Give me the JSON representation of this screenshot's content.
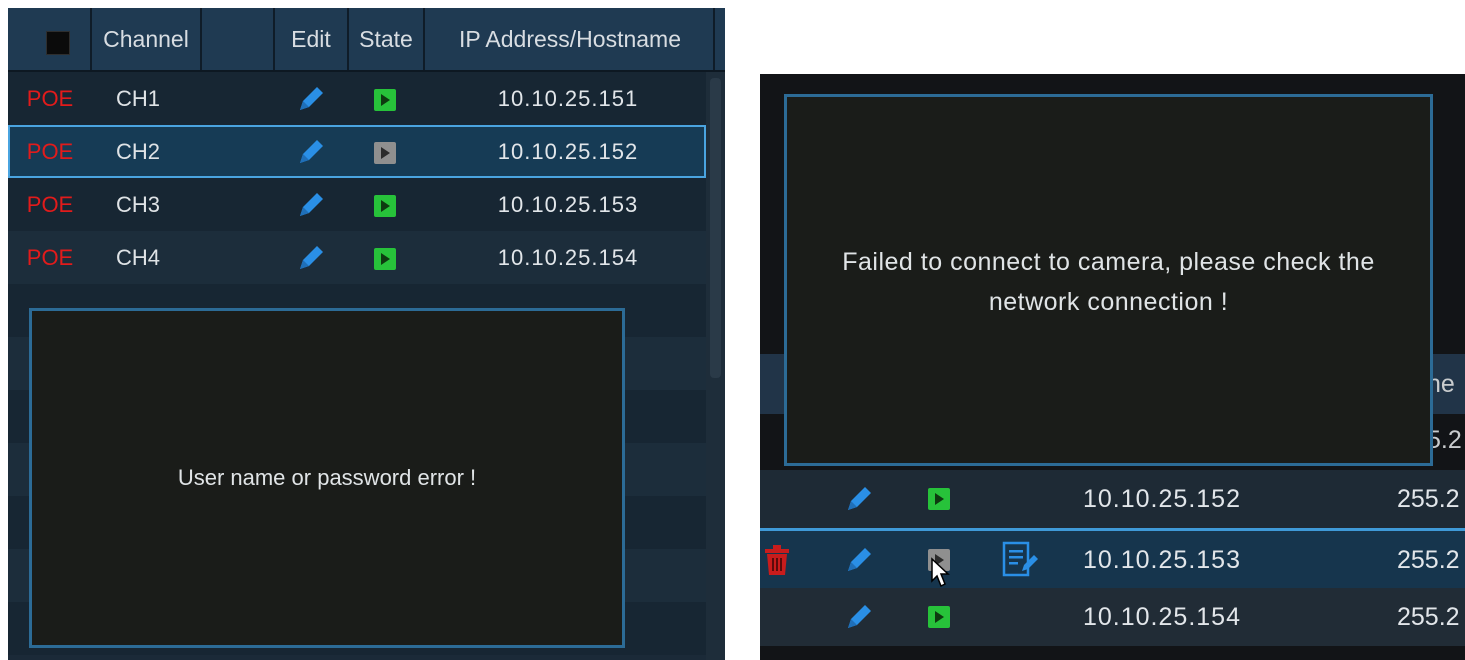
{
  "left": {
    "headers": {
      "channel": "Channel",
      "edit": "Edit",
      "state": "State",
      "ip": "IP Address/Hostname"
    },
    "rows": [
      {
        "poe": "POE",
        "channel": "CH1",
        "ip": "10.10.25.151",
        "state": "online",
        "selected": false
      },
      {
        "poe": "POE",
        "channel": "CH2",
        "ip": "10.10.25.152",
        "state": "offline",
        "selected": true
      },
      {
        "poe": "POE",
        "channel": "CH3",
        "ip": "10.10.25.153",
        "state": "online",
        "selected": false
      },
      {
        "poe": "POE",
        "channel": "CH4",
        "ip": "10.10.25.154",
        "state": "online",
        "selected": false
      }
    ],
    "dialog_message": "User name or password error !"
  },
  "right": {
    "dialog_message_line1": "Failed to connect to camera, please check the",
    "dialog_message_line2": "network connection !",
    "header_partial": "ne",
    "row0_partial": "5.2",
    "rows": [
      {
        "ip": "10.10.25.152",
        "mask": "255.2",
        "state": "online",
        "selected": false
      },
      {
        "ip": "10.10.25.153",
        "mask": "255.2",
        "state": "offline",
        "selected": true
      },
      {
        "ip": "10.10.25.154",
        "mask": "255.2",
        "state": "online",
        "selected": false
      }
    ]
  },
  "colors": {
    "poe_red": "#e21b1b",
    "state_green": "#27c23a",
    "state_gray": "#8f8f8f",
    "edit_blue": "#2a8fe6",
    "selection_blue": "#4aa4e0",
    "delete_red": "#c81c1c"
  },
  "icons": {
    "edit": "pencil-icon",
    "state": "play-icon",
    "delete": "trash-icon",
    "log": "document-icon",
    "cursor": "mouse-pointer-icon"
  }
}
